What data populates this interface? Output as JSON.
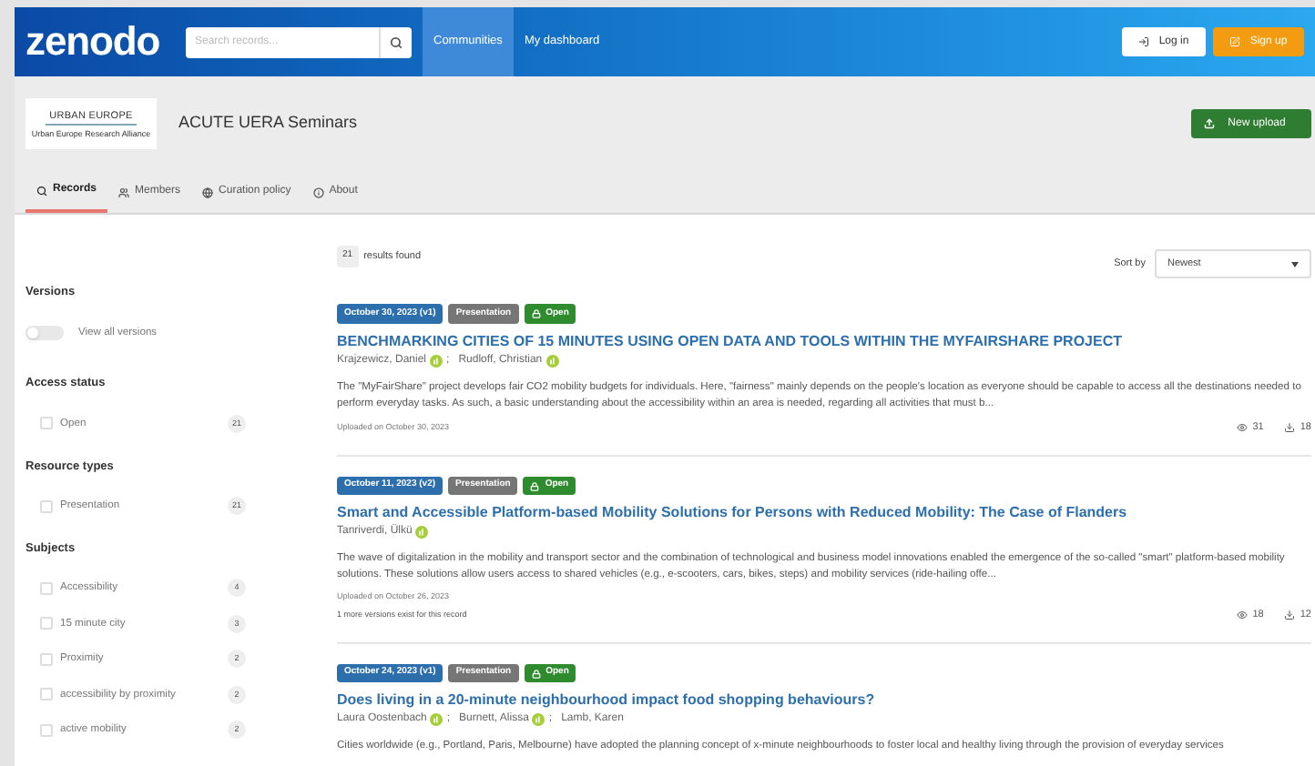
{
  "header": {
    "logo": "zenodo",
    "search": {
      "placeholder": "Search records..."
    },
    "nav": [
      {
        "label": "Communities",
        "selected": true
      },
      {
        "label": "My dashboard",
        "selected": false
      }
    ],
    "login": "Log in",
    "signup": "Sign up"
  },
  "community": {
    "logo_top": "URBAN EUROPE",
    "logo_bottom": "Urban Europe Research Alliance",
    "title": "ACUTE UERA Seminars",
    "new_upload": "New upload",
    "tabs": [
      {
        "label": "Records",
        "kind": "search",
        "selected": true
      },
      {
        "label": "Members",
        "kind": "users",
        "selected": false
      },
      {
        "label": "Curation policy",
        "kind": "globe",
        "selected": false
      },
      {
        "label": "About",
        "kind": "info",
        "selected": false
      }
    ]
  },
  "filters": {
    "versions": {
      "heading": "Versions",
      "toggle": {
        "label": "View all versions",
        "on": false
      }
    },
    "groups": [
      {
        "heading": "Access status",
        "items": [
          {
            "label": "Open",
            "count": "21",
            "checked": false
          }
        ]
      },
      {
        "heading": "Resource types",
        "items": [
          {
            "label": "Presentation",
            "count": "21",
            "checked": false
          }
        ]
      },
      {
        "heading": "Subjects",
        "items": [
          {
            "label": "Accessibility",
            "count": "4",
            "checked": false
          },
          {
            "label": "15 minute city",
            "count": "3",
            "checked": false
          },
          {
            "label": "Proximity",
            "count": "2",
            "checked": false
          },
          {
            "label": "accessibility by proximity",
            "count": "2",
            "checked": false
          },
          {
            "label": "active mobility",
            "count": "2",
            "checked": false
          }
        ]
      }
    ]
  },
  "results": {
    "count": "21",
    "label": "results found",
    "sort_label": "Sort by",
    "sort": "Newest",
    "records": [
      {
        "date": "October 30, 2023 (v1)",
        "type": "Presentation",
        "access": "Open",
        "title": "BENCHMARKING CITIES OF 15 MINUTES USING OPEN DATA AND TOOLS WITHIN THE MYFAIRSHARE PROJECT",
        "authors": [
          {
            "name": "Krajzewicz, Daniel",
            "orcid": true,
            "sep": ";"
          },
          {
            "name": "Rudloff, Christian",
            "orcid": true
          }
        ],
        "description": "The \"MyFairShare\" project develops fair CO2 mobility budgets for individuals. Here, \"fairness\" mainly depends on the people's location as everyone should be capable to access all the destinations needed to perform everyday tasks. As such, a basic understanding about the accessibility within an area is needed, regarding all activities that must b...",
        "uploaded": "Uploaded on October 30, 2023",
        "views": "31",
        "downloads": "18"
      },
      {
        "date": "October 11, 2023 (v2)",
        "type": "Presentation",
        "access": "Open",
        "title": "Smart and Accessible Platform-based Mobility Solutions for Persons with Reduced Mobility: The Case of Flanders",
        "authors": [
          {
            "name": "Tanriverdi, Ülkü",
            "orcid": true
          }
        ],
        "description": "The wave of digitalization in the mobility and transport sector and the combination of technological and business model innovations enabled the emergence of the so-called \"smart\" platform-based mobility solutions. These solutions allow users access to shared vehicles (e.g., e-scooters, cars, bikes, steps) and mobility services (ride-hailing offe...",
        "uploaded": "Uploaded on October 26, 2023",
        "versions_note": "1 more versions exist for this record",
        "views": "18",
        "downloads": "12"
      },
      {
        "date": "October 24, 2023 (v1)",
        "type": "Presentation",
        "access": "Open",
        "title": "Does living in a 20-minute neighbourhood impact food shopping behaviours?",
        "authors": [
          {
            "name": "Laura Oostenbach",
            "orcid": true,
            "sep": ";"
          },
          {
            "name": "Burnett, Alissa",
            "orcid": true,
            "sep": ";"
          },
          {
            "name": "Lamb, Karen",
            "orcid": false
          }
        ],
        "description": "Cities worldwide (e.g., Portland, Paris, Melbourne) have adopted the planning concept of x-minute neighbourhoods to foster local and healthy living through the provision of everyday services"
      }
    ]
  }
}
